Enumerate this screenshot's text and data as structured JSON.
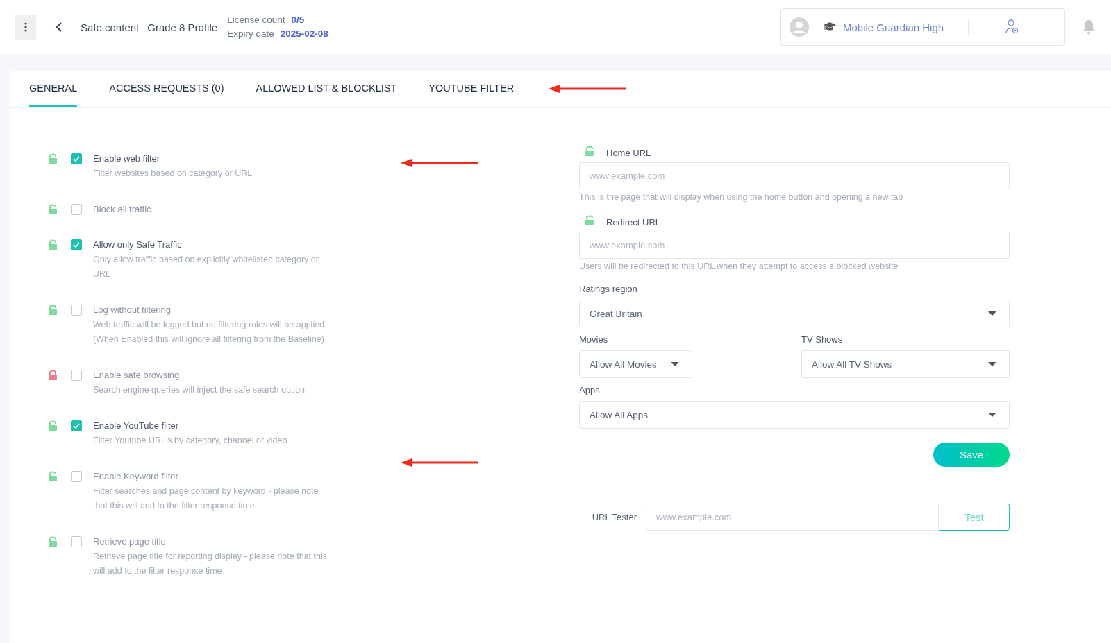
{
  "header": {
    "breadcrumb": [
      "Safe content",
      "Grade 8 Profile"
    ],
    "license_label": "License count",
    "license_value": "0/5",
    "expiry_label": "Expiry date",
    "expiry_value": "2025-02-08",
    "school": "Mobile Guardian High"
  },
  "tabs": [
    {
      "label": "GENERAL",
      "selected": true
    },
    {
      "label": "ACCESS REQUESTS (0)",
      "selected": false
    },
    {
      "label": "ALLOWED LIST & BLOCKLIST",
      "selected": false
    },
    {
      "label": "YOUTUBE FILTER",
      "selected": false
    }
  ],
  "settings": [
    {
      "title": "Enable web filter",
      "description": "Filter websites based on category or URL",
      "checked": true,
      "locked": false
    },
    {
      "title": "Block all traffic",
      "checked": false,
      "locked": false
    },
    {
      "title": "Allow only Safe Traffic",
      "description": "Only allow traffic based on explicitly whitelisted category or URL",
      "checked": true,
      "locked": false
    },
    {
      "title": "Log without filtering",
      "description": "Web traffic will be logged but no filtering rules will be applied. (When Enabled this will ignore all filtering from the Baseline)",
      "checked": false,
      "locked": false
    },
    {
      "title": "Enable safe browsing",
      "description": "Search engine queries will inject the safe search option",
      "checked": false,
      "locked": true
    },
    {
      "title": "Enable YouTube filter",
      "description": "Filter Youtube URL's by category, channel or video",
      "checked": true,
      "locked": false
    },
    {
      "title": "Enable Keyword filter",
      "description": "Filter searches and page content by keyword - please note that this will add to the filter response time",
      "checked": false,
      "locked": false
    },
    {
      "title": "Retrieve page title",
      "description": "Retrieve page title for reporting display - please note that this will add to the filter response time",
      "checked": false,
      "locked": false
    }
  ],
  "url_fields": [
    {
      "label": "Home URL",
      "placeholder": "www.example.com",
      "help": "This is the page that will display when using the home button and opening a new tab",
      "locked": false
    },
    {
      "label": "Redirect URL",
      "placeholder": "www.example.com",
      "help": "Users will be redirected to this URL when they attempt to access a blocked website",
      "locked": false
    }
  ],
  "ratings_region": {
    "label": "Ratings region",
    "value": "Great Britain"
  },
  "movies": {
    "label": "Movies",
    "value": "Allow All Movies"
  },
  "tv_shows": {
    "label": "TV Shows",
    "value": "Allow All TV Shows"
  },
  "apps": {
    "label": "Apps",
    "value": "Allow All Apps"
  },
  "save_button": "Save",
  "url_tester": {
    "label": "URL Tester",
    "placeholder": "www.example.com",
    "button": "Test"
  }
}
